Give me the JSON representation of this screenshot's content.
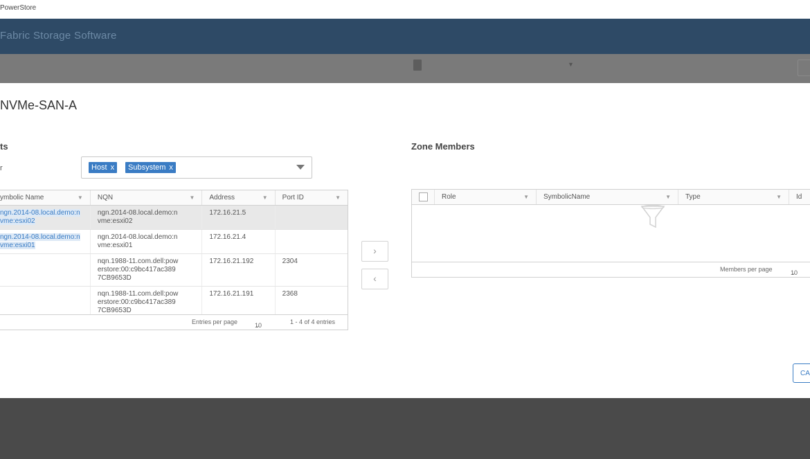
{
  "app": {
    "name": "PowerStore"
  },
  "header": {
    "title": "Fabric Storage Software"
  },
  "dialog": {
    "title": "NVMe-SAN-A",
    "left_section_title": "ts",
    "filter": {
      "label": "r",
      "chips": [
        "Host",
        "Subsystem"
      ],
      "chip_remove": "x"
    },
    "endpoints": {
      "columns": [
        "ymbolic Name",
        "NQN",
        "Address",
        "Port ID"
      ],
      "rows": [
        {
          "symbolic": "ngn.2014-08.local.demo:n vme:esxi02",
          "nqn": "ngn.2014-08.local.demo:n vme:esxi02",
          "address": "172.16.21.5",
          "port": ""
        },
        {
          "symbolic": "ngn.2014-08.local.demo:n vme:esxi01",
          "nqn": "ngn.2014-08.local.demo:n vme:esxi01",
          "address": "172.16.21.4",
          "port": ""
        },
        {
          "symbolic": "",
          "nqn": "nqn.1988-11.com.dell:pow erstore:00:c9bc417ac389 7CB9653D",
          "address": "172.16.21.192",
          "port": "2304"
        },
        {
          "symbolic": "",
          "nqn": "nqn.1988-11.com.dell:pow erstore:00:c9bc417ac389 7CB9653D",
          "address": "172.16.21.191",
          "port": "2368"
        }
      ],
      "entries_per_page_label": "Entries per page",
      "entries_per_page_value": "10",
      "entries_count": "1 - 4 of 4 entries"
    },
    "move_right": "›",
    "move_left": "‹",
    "zone_members": {
      "title": "Zone Members",
      "columns": [
        "Role",
        "SymbolicName",
        "Type",
        "Id"
      ],
      "empty_text": "",
      "members_per_page_label": "Members per page",
      "members_per_page_value": "10"
    },
    "cancel_label": "CA"
  },
  "icons": {
    "filter": "filter-icon",
    "caret": "chevron-down-icon",
    "empty": "funnel-icon"
  }
}
